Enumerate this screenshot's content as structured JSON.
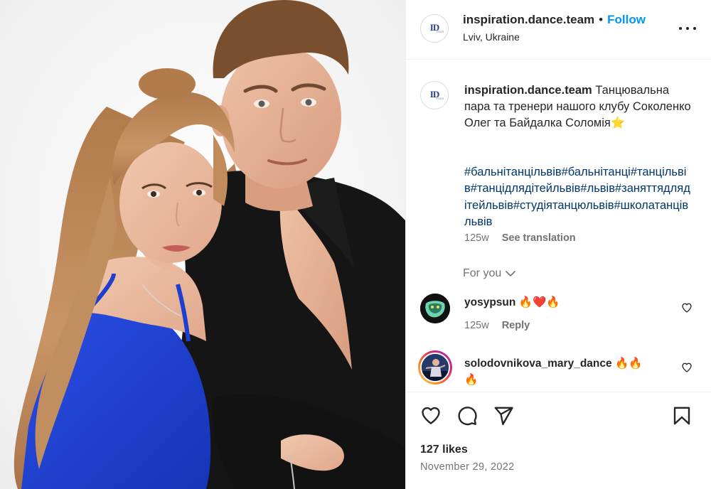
{
  "post": {
    "username": "inspiration.dance.team",
    "follow_label": "Follow",
    "separator": "•",
    "location": "Lviv, Ukraine",
    "logo_monogram": "ID",
    "logo_sub": "Team"
  },
  "caption": {
    "username": "inspiration.dance.team",
    "text": "Танцювальна пара та тренери нашого клубу Соколенко Олег та Байдалка Соломія⭐",
    "hashtags": "#бальнітанцільвів#бальнітанці#танцільвів#танцідлядітейльвів#львів#заняттядлядітейльвів#студіятанцюльвів#школатанцівльвів",
    "age": "125w",
    "see_translation": "See translation"
  },
  "for_you_label": "For you",
  "comments": [
    {
      "username": "yosypsun",
      "text": "🔥❤️🔥",
      "age": "125w",
      "reply_label": "Reply"
    },
    {
      "username": "solodovnikova_mary_dance",
      "text": "🔥🔥",
      "text_wrap": "🔥"
    }
  ],
  "likes": "127 likes",
  "date": "November 29, 2022",
  "colors": {
    "follow_blue": "#0095f6",
    "hashtag_blue": "#00376b",
    "muted_gray": "#737373",
    "dress_blue": "#1f3fd1",
    "shirt_black": "#141414"
  },
  "icons": {
    "more": "more-horizontal-icon",
    "like": "heart-icon",
    "comment": "comment-icon",
    "share": "share-icon",
    "save": "bookmark-icon"
  }
}
